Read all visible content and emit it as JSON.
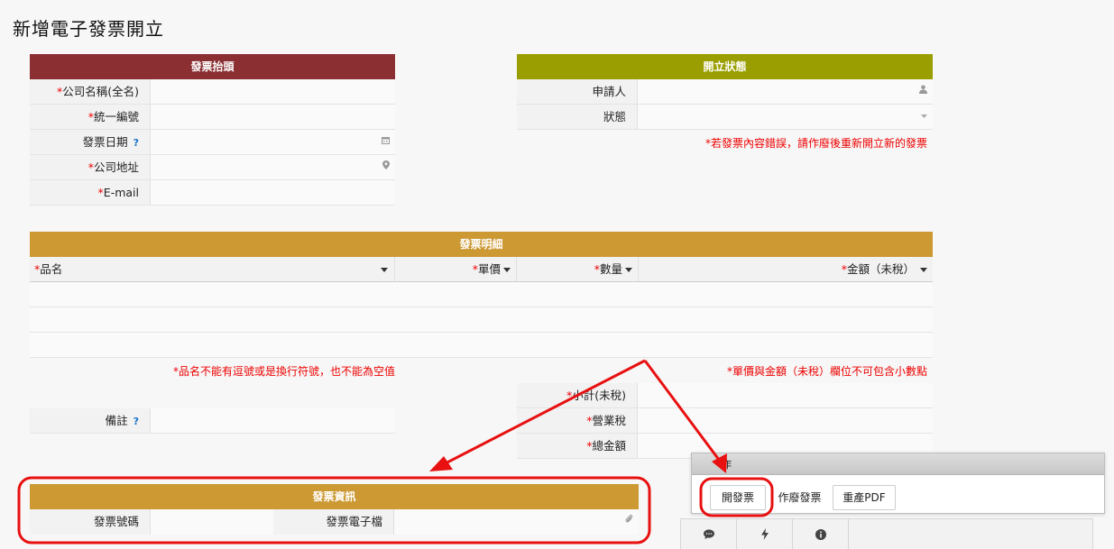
{
  "page": {
    "title": "新增電子發票開立"
  },
  "invoice_header": {
    "section_title": "發票抬頭",
    "fields": [
      {
        "label": "公司名稱(全名)",
        "required": "*"
      },
      {
        "label": "統一編號",
        "required": "*"
      },
      {
        "label": "發票日期",
        "help": "?"
      },
      {
        "label": "公司地址",
        "required": "*"
      },
      {
        "label": "E-mail",
        "required": "*"
      }
    ]
  },
  "status_panel": {
    "section_title": "開立狀態",
    "fields": [
      {
        "label": "申請人"
      },
      {
        "label": "狀態"
      }
    ],
    "note": "*若發票內容錯誤，請作廢後重新開立新的發票"
  },
  "details": {
    "section_title": "發票明細",
    "columns": [
      {
        "required": "*",
        "label": "品名"
      },
      {
        "required": "*",
        "label": "單價"
      },
      {
        "required": "*",
        "label": "數量"
      },
      {
        "required": "*",
        "label": "金額（未稅）"
      }
    ],
    "note_left": "*品名不能有逗號或是換行符號，也不能為空值",
    "note_right": "*單價與金額（未稅）欄位不可包含小數點"
  },
  "remarks": {
    "label": "備註",
    "help": "?"
  },
  "totals": [
    {
      "required": "*",
      "label": "小計(未稅)"
    },
    {
      "required": "*",
      "label": "營業稅"
    },
    {
      "required": "*",
      "label": "總金額"
    }
  ],
  "invoice_info": {
    "section_title": "發票資訊",
    "number_label": "發票號碼",
    "file_label": "發票電子檔"
  },
  "action_panel": {
    "title": "作",
    "buttons": {
      "issue": "開發票",
      "void": "作廢發票",
      "regen": "重產PDF"
    }
  },
  "colors": {
    "header_dark_red": "#8b2f33",
    "header_olive": "#9a9e00",
    "header_gold": "#cc9933",
    "annotation_red": "#e81010"
  },
  "icons": [
    "calendar-icon",
    "map-pin-icon",
    "user-icon",
    "dropdown-icon",
    "paperclip-icon",
    "comment-icon",
    "bolt-icon",
    "info-icon"
  ]
}
